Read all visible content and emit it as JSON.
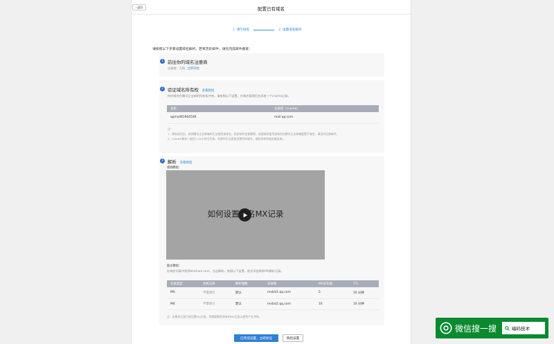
{
  "header": {
    "back_label": "返回",
    "title": "配置已有域名"
  },
  "steps": {
    "step1": "1. 填写域名",
    "step2": "2. 设置域名解析"
  },
  "intro": "请按照以下步骤设置域名解析。若有历史邮件，请先完成邮件搬家：",
  "section1": {
    "num": "1",
    "title": "前往你的域名注册商",
    "registrar_label": "注册商：",
    "registrar_value": "万网",
    "go_link": "立即前往"
  },
  "section2": {
    "num": "2",
    "title": "验证域名所有权",
    "tutorial_link": "查看教程",
    "desc": "你的域名在腾讯企业邮的所有权冲突。请按照以下设置，在域名管理后台添加一个cname记录。",
    "columns": [
      "主机",
      "记录值（cname）"
    ],
    "rows": [
      [
        "qqmail81664548",
        "mail.qq.com"
      ]
    ],
    "note_title": "注：",
    "note_lines": [
      "1、解析成功后，其他腾讯企业邮箱的无法使用该域名，相关邮件会被删除。若要继续使用该域名在腾讯企业邮箱配置子域名，请及时迁移邮件。",
      "2、CNAME解析一般在2-24小时内生效。如果你无法直接设置你的域名，请联系你的域名服务商。"
    ]
  },
  "section3": {
    "num": "3",
    "title": "解析",
    "tutorial_link": "查看教程",
    "video_label": "视频教程：",
    "video_title": "如何设置域名MX记录",
    "text_label": "图文教程：",
    "text_desc": "在域名列表中找到bilishare.com，点击解析，按照以下设置，依次添加两条MX解析记录。",
    "columns": [
      "记录类型",
      "主机记录",
      "解析线路",
      "记录值",
      "MX优先级",
      "TTL"
    ],
    "rows": [
      [
        "MX",
        "不需填写",
        "默认",
        "mxbiz1.qq.com",
        "5",
        "10 分钟"
      ],
      [
        "MX",
        "不需填写",
        "默认",
        "mxbiz2.qq.com",
        "10",
        "10 分钟"
      ]
    ],
    "footnote": "注：如果你之前已经设置MX记录，你需要删除原有的MX记录以避免产生冲突。"
  },
  "buttons": {
    "confirm": "已完成设置，立即验证",
    "later": "稍后设置"
  },
  "watermark": {
    "brand": "微信搜一搜",
    "query": "编码技术"
  },
  "colors": {
    "accent": "#2f7fd6",
    "step_number": "#2a6fc2",
    "table_header": "#a7adb8",
    "watermark_bg": "#0a8a2f"
  }
}
